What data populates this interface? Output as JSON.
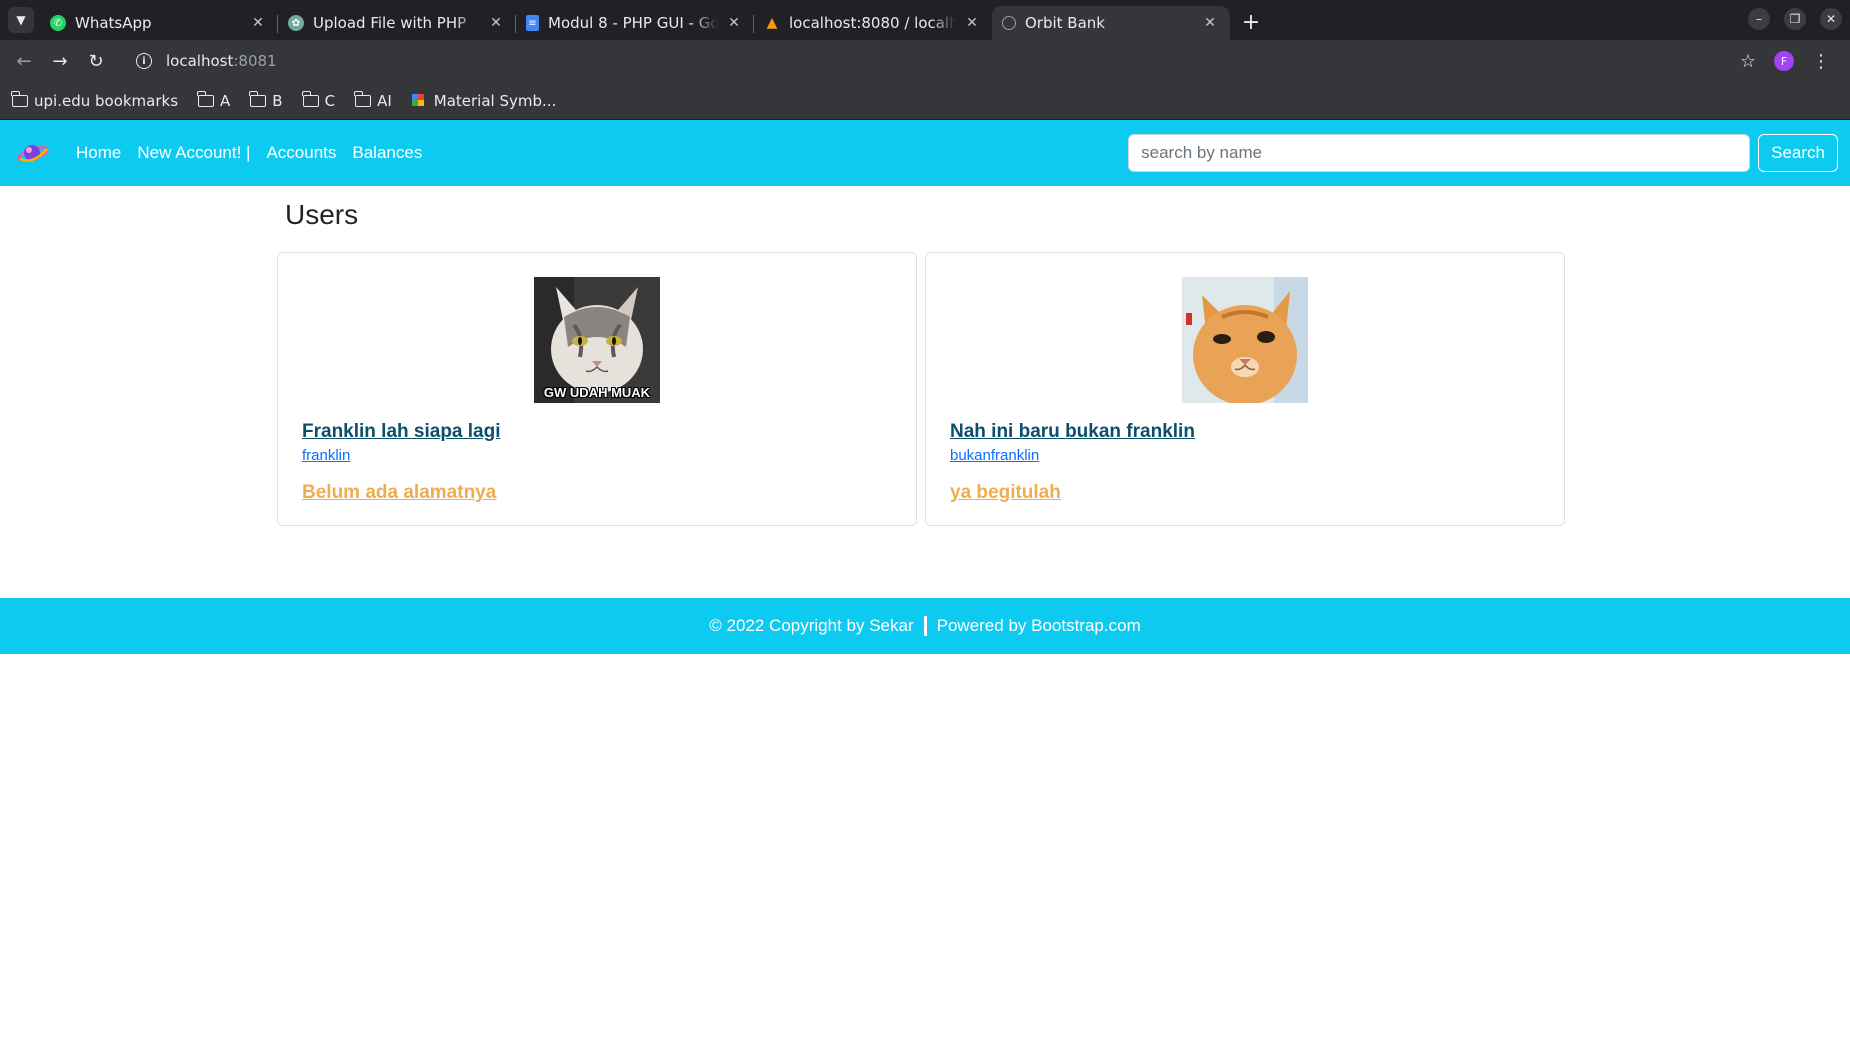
{
  "browser": {
    "tabs": [
      {
        "title": "WhatsApp",
        "icon": "whatsapp-icon",
        "color": "#25d366"
      },
      {
        "title": "Upload File with PHP",
        "icon": "chatgpt-icon",
        "color": "#74aa9c"
      },
      {
        "title": "Modul 8 - PHP GUI - Goo",
        "icon": "google-docs-icon",
        "color": "#4285f4"
      },
      {
        "title": "localhost:8080 / localhos",
        "icon": "phpmyadmin-icon",
        "color": "#f89c0e"
      },
      {
        "title": "Orbit Bank",
        "icon": "globe-icon",
        "color": "#9aa0a6"
      }
    ],
    "address": {
      "host": "localhost",
      "port": ":8081"
    },
    "profile_initial": "F",
    "bookmarks": [
      {
        "label": "upi.edu bookmarks",
        "icon": "managed-folder-icon"
      },
      {
        "label": "A",
        "icon": "folder-icon"
      },
      {
        "label": "B",
        "icon": "folder-icon"
      },
      {
        "label": "C",
        "icon": "folder-icon"
      },
      {
        "label": "AI",
        "icon": "folder-icon"
      },
      {
        "label": "Material Symb...",
        "icon": "material-icon"
      }
    ]
  },
  "navbar": {
    "links": [
      "Home",
      "New Account! |",
      "Accounts",
      "Balances"
    ],
    "search_placeholder": "search by name",
    "search_button": "Search"
  },
  "page": {
    "heading": "Users",
    "users": [
      {
        "name": "Franklin lah siapa lagi",
        "username": "franklin",
        "address": "Belum ada alamatnya",
        "image_caption": "GW UDAH MUAK"
      },
      {
        "name": "Nah ini baru bukan franklin",
        "username": "bukanfranklin",
        "address": "ya begitulah"
      }
    ]
  },
  "footer": {
    "copyright": "© 2022 Copyright by Sekar",
    "powered": "Powered by Bootstrap.com"
  },
  "colors": {
    "accent": "#0dcaf0",
    "name_link": "#0b4f6c",
    "address_link": "#f0ad4e"
  }
}
